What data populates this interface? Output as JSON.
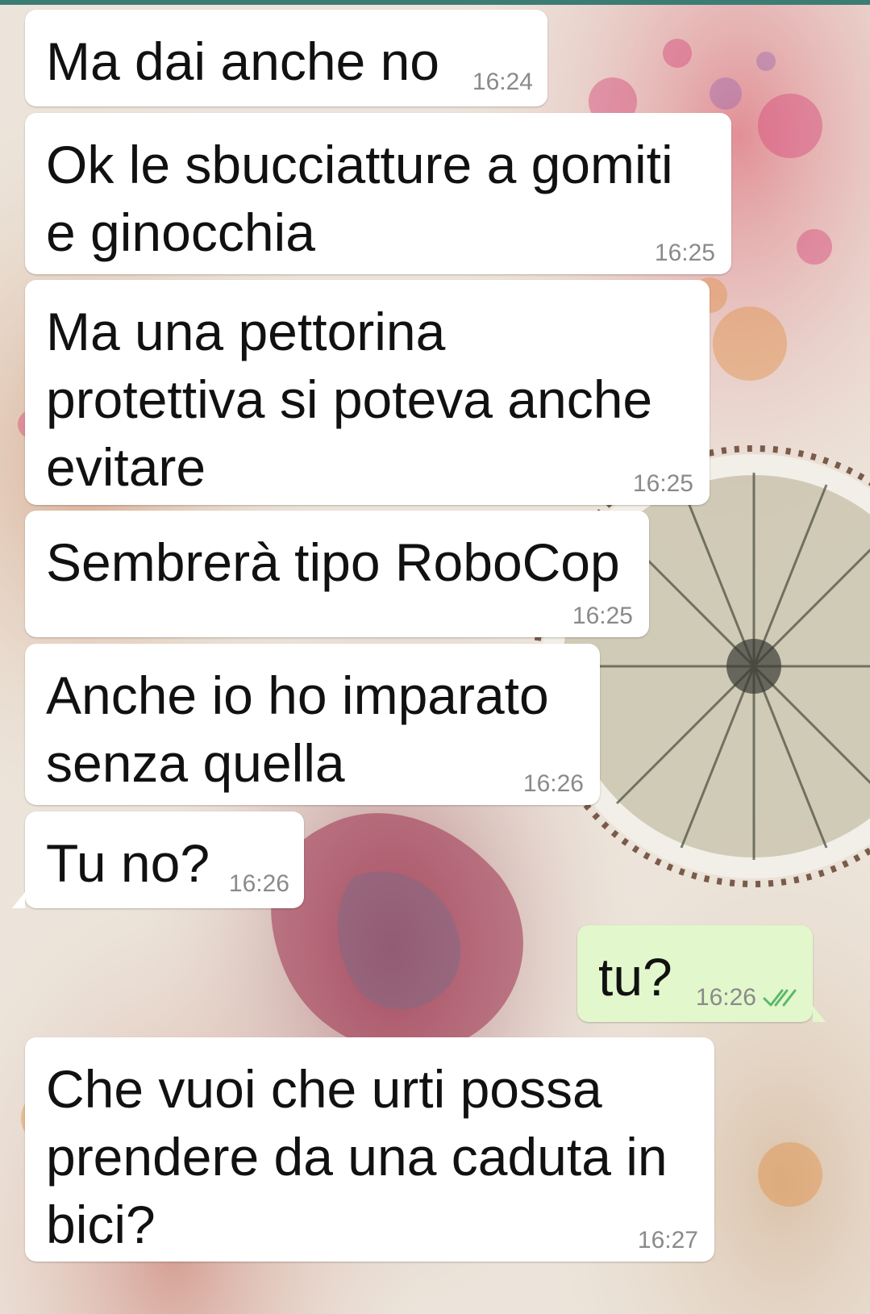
{
  "theme": {
    "incoming_bubble": "#ffffff",
    "outgoing_bubble": "#e2f7cb",
    "timestamp": "#8a8a8a",
    "read_ticks": "#4fc3f7"
  },
  "messages": [
    {
      "direction": "in",
      "text": "Ma dai anche no",
      "time": "16:24"
    },
    {
      "direction": "in",
      "text": "Ok le sbucciatture a gomiti\ne ginocchia",
      "time": "16:25"
    },
    {
      "direction": "in",
      "text": "Ma una pettorina\nprotettiva si poteva anche\nevitare",
      "time": "16:25"
    },
    {
      "direction": "in",
      "text": "Sembrerà tipo RoboCop",
      "time": "16:25"
    },
    {
      "direction": "in",
      "text": "Anche io ho imparato\nsenza quella",
      "time": "16:26"
    },
    {
      "direction": "in",
      "text": "Tu no?",
      "time": "16:26"
    },
    {
      "direction": "out",
      "text": "tu?",
      "time": "16:26",
      "status_icon": "double-check-read-icon"
    },
    {
      "direction": "in",
      "text": "Che vuoi che urti possa\nprendere da una caduta in\nbici?",
      "time": "16:27"
    }
  ]
}
